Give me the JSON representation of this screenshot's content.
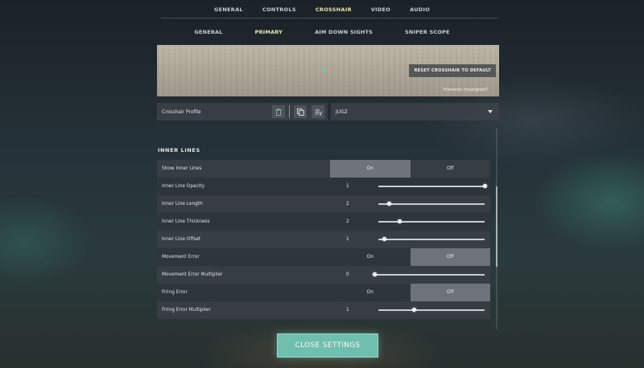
{
  "top_tabs": [
    {
      "label": "GENERAL",
      "active": false
    },
    {
      "label": "CONTROLS",
      "active": false
    },
    {
      "label": "CROSSHAIR",
      "active": true
    },
    {
      "label": "VIDEO",
      "active": false
    },
    {
      "label": "AUDIO",
      "active": false
    }
  ],
  "sub_tabs": [
    {
      "label": "GENERAL",
      "active": false
    },
    {
      "label": "PRIMARY",
      "active": true
    },
    {
      "label": "AIM DOWN SIGHTS",
      "active": false
    },
    {
      "label": "SNIPER SCOPE",
      "active": false
    }
  ],
  "preview": {
    "reset_label": "RESET CROSSHAIR TO DEFAULT",
    "misaligned_text": "Elements misaligned?",
    "crosshair_color": "#3fe3d3"
  },
  "profile": {
    "label": "Crosshair Profile",
    "icons": [
      "trash-icon",
      "copy-icon",
      "import-icon"
    ],
    "selected": "JUGZ"
  },
  "section": {
    "title": "INNER LINES"
  },
  "rows": [
    {
      "label": "Show Inner Lines",
      "type": "toggle",
      "on": "On",
      "off": "Off",
      "value": "on"
    },
    {
      "label": "Inner Line Opacity",
      "type": "slider",
      "value": "1",
      "fraction": 1.0
    },
    {
      "label": "Inner Line Length",
      "type": "slider",
      "value": "2",
      "fraction": 0.1
    },
    {
      "label": "Inner Line Thickness",
      "type": "slider",
      "value": "2",
      "fraction": 0.2
    },
    {
      "label": "Inner Line Offset",
      "type": "slider",
      "value": "1",
      "fraction": 0.05
    },
    {
      "label": "Movement Error",
      "type": "toggle",
      "on": "On",
      "off": "Off",
      "value": "off"
    },
    {
      "label": "Movement Error Multiplier",
      "type": "slider",
      "value": "0",
      "fraction": 0.0
    },
    {
      "label": "Firing Error",
      "type": "toggle",
      "on": "On",
      "off": "Off",
      "value": "off"
    },
    {
      "label": "Firing Error Multiplier",
      "type": "slider",
      "value": "1",
      "fraction": 0.33
    }
  ],
  "close_button": {
    "label": "CLOSE SETTINGS",
    "color": "#6fbfae"
  }
}
